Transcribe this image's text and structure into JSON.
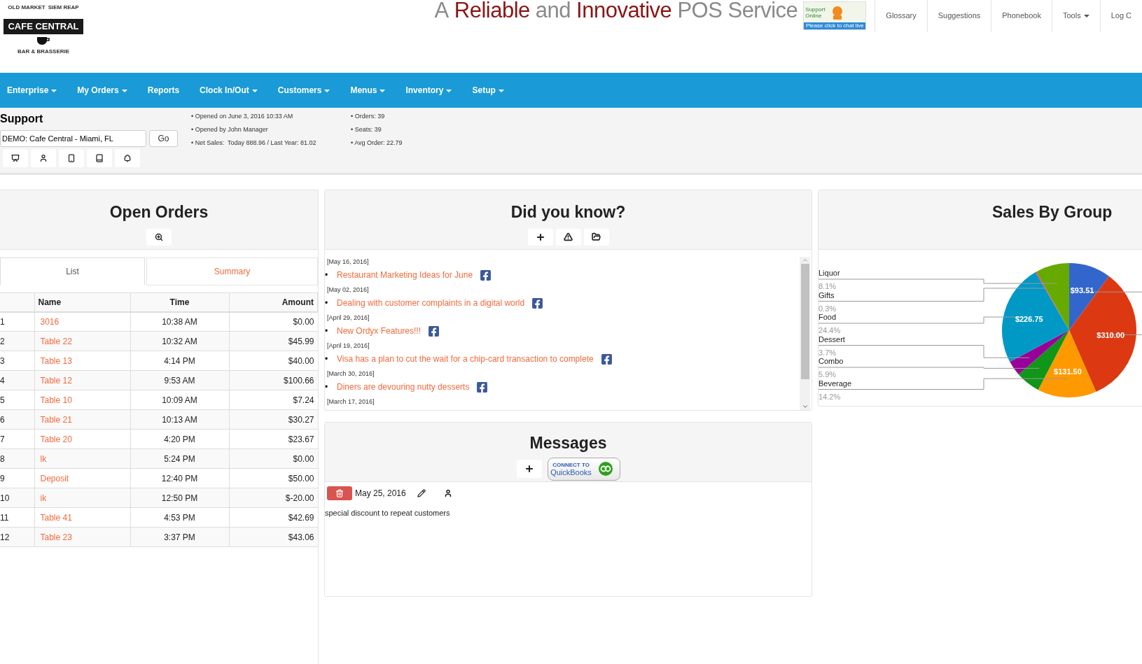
{
  "logo": {
    "top_left": "OLD MARKET",
    "top_right": "SIEM REAP",
    "name": "CAFE CENTRAL",
    "tagline": "BAR & BRASSERIE"
  },
  "slogan": [
    {
      "text": "A",
      "emphasis": false
    },
    {
      "text": "Reliable",
      "emphasis": true
    },
    {
      "text": "and",
      "emphasis": false
    },
    {
      "text": "Innovative",
      "emphasis": true
    },
    {
      "text": "POS Service",
      "emphasis": false
    }
  ],
  "support_badge": {
    "label": "Support Online",
    "banner": "Please click to chat live"
  },
  "top_links": [
    {
      "label": "Glossary",
      "dropdown": false
    },
    {
      "label": "Suggestions",
      "dropdown": false
    },
    {
      "label": "Phonebook",
      "dropdown": false
    },
    {
      "label": "Tools",
      "dropdown": true
    },
    {
      "label": "Log C",
      "dropdown": false
    }
  ],
  "menu": [
    {
      "label": "Enterprise",
      "dropdown": true
    },
    {
      "label": "My Orders",
      "dropdown": true
    },
    {
      "label": "Reports",
      "dropdown": false
    },
    {
      "label": "Clock In/Out",
      "dropdown": true
    },
    {
      "label": "Customers",
      "dropdown": true
    },
    {
      "label": "Menus",
      "dropdown": true
    },
    {
      "label": "Inventory",
      "dropdown": true
    },
    {
      "label": "Setup",
      "dropdown": true
    }
  ],
  "support": {
    "title": "Support",
    "store": "DEMO: Cafe Central - Miami, FL",
    "go": "Go",
    "stats_left": [
      "• Opened on June 3, 2016 10:33 AM",
      "• Opened by John Manager",
      "• Net Sales:  Today 888.96 / Last Year: 81.02"
    ],
    "stats_right": [
      "• Orders: 39",
      "• Seats: 39",
      "• Avg Order: 22.79"
    ]
  },
  "open_orders": {
    "title": "Open Orders",
    "tabs": [
      {
        "label": "List",
        "selected": true
      },
      {
        "label": "Summary",
        "selected": false
      }
    ],
    "columns": [
      "Name",
      "Time",
      "Amount"
    ],
    "rows": [
      {
        "number": "1",
        "name": "3016",
        "time": "10:38 AM",
        "amount": "$0.00"
      },
      {
        "number": "2",
        "name": "Table 22",
        "time": "10:32 AM",
        "amount": "$45.99"
      },
      {
        "number": "3",
        "name": "Table 13",
        "time": "4:14 PM",
        "amount": "$40.00"
      },
      {
        "number": "4",
        "name": "Table 12",
        "time": "9:53 AM",
        "amount": "$100.66"
      },
      {
        "number": "5",
        "name": "Table 10",
        "time": "10:09 AM",
        "amount": "$7.24"
      },
      {
        "number": "6",
        "name": "Table 21",
        "time": "10:13 AM",
        "amount": "$30.27"
      },
      {
        "number": "7",
        "name": "Table 20",
        "time": "4:20 PM",
        "amount": "$23.67"
      },
      {
        "number": "8",
        "name": "lk",
        "time": "5:24 PM",
        "amount": "$0.00"
      },
      {
        "number": "9",
        "name": "Deposit",
        "time": "12:40 PM",
        "amount": "$50.00"
      },
      {
        "number": "10",
        "name": "ik",
        "time": "12:50 PM",
        "amount": "$-20.00"
      },
      {
        "number": "11",
        "name": "Table 41",
        "time": "4:53 PM",
        "amount": "$42.69"
      },
      {
        "number": "12",
        "name": "Table 23",
        "time": "3:37 PM",
        "amount": "$43.06"
      }
    ]
  },
  "did_you_know": {
    "title": "Did you know?",
    "entries": [
      {
        "date": "[May 16, 2016]",
        "bullet": "•",
        "title": "Restaurant Marketing Ideas for June"
      },
      {
        "date": "[May 02, 2016]",
        "bullet": "•",
        "title": "Dealing with customer complaints in a digital world"
      },
      {
        "date": "[April 29, 2016]",
        "bullet": "•",
        "title": "New Ordyx Features!!!"
      },
      {
        "date": "[April 19, 2016]",
        "bullet": "•",
        "title": "Visa has a plan to cut the wait for a chip-card transaction to complete"
      },
      {
        "date": "[March 30, 2016]",
        "bullet": "•",
        "title": "Diners are devouring nutty desserts"
      },
      {
        "date": "[March 17, 2016]"
      }
    ]
  },
  "messages": {
    "title": "Messages",
    "quickbooks": {
      "small": "CONNECT TO",
      "name": "QuickBooks"
    },
    "items": [
      {
        "date": "May 25, 2016",
        "text": "special discount to repeat customers"
      }
    ]
  },
  "sales_by_group": {
    "title": "Sales By Group",
    "legend_percents": [
      "8.1%",
      "0.3%",
      "24.4%",
      "3.7%",
      "5.9%",
      "14.2%"
    ],
    "chart_data": {
      "type": "pie",
      "categories": [
        null,
        null,
        "Beverage",
        "Combo",
        "Dessert",
        "Food",
        "Gifts",
        "Liquor"
      ],
      "series": [
        {
          "values": [
            10.1,
            33.4,
            14.2,
            5.9,
            3.7,
            24.4,
            0.3,
            8.1
          ]
        }
      ],
      "colors": [
        "#3366cc",
        "#dc3912",
        "#ff9900",
        "#109618",
        "#990099",
        "#0099c6",
        "#dd4477",
        "#66aa00"
      ],
      "value_labels": [
        "$93.51",
        "$310.00",
        "$131.50",
        null,
        null,
        "$226.75",
        null,
        null
      ]
    }
  }
}
